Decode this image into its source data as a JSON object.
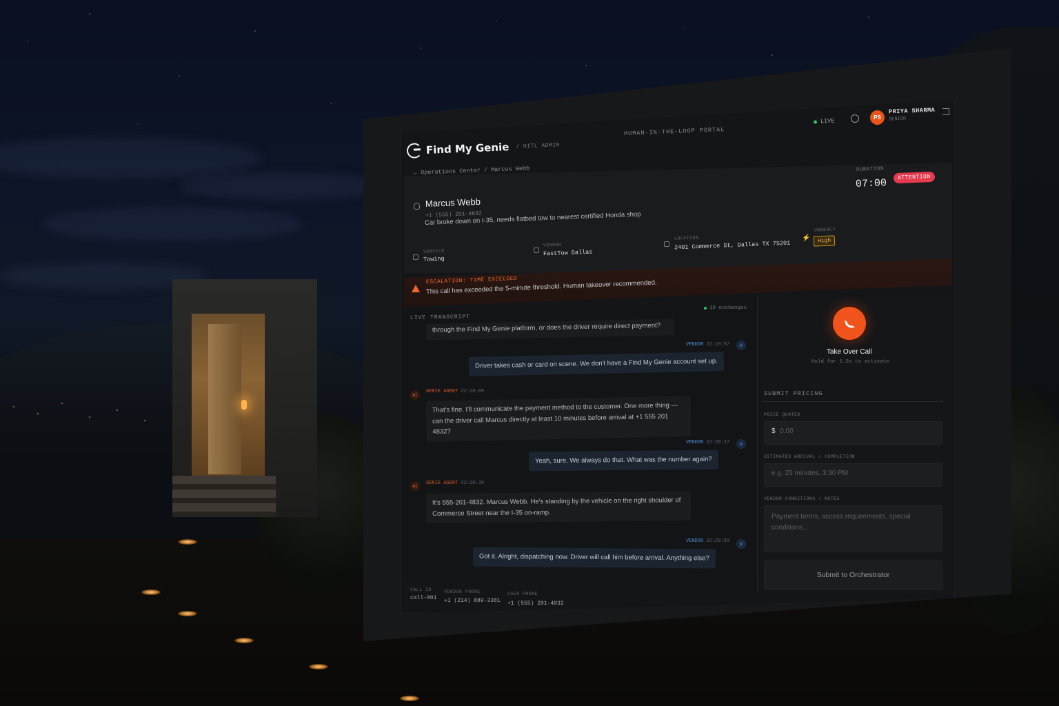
{
  "header": {
    "brand_name": "Find My Genie",
    "brand_sub": "/ HITL ADMIN",
    "portal_label": "HUMAN-IN-THE-LOOP PORTAL",
    "live_label": "LIVE",
    "user": {
      "initials": "PS",
      "name": "PRIYA SHARMA",
      "role": "SENIOR"
    }
  },
  "breadcrumb": {
    "text": "← Operations Center / Marcus Webb"
  },
  "call": {
    "duration_label": "DURATION",
    "duration_value": "07:00",
    "status_badge": "ATTENTION",
    "caller_name": "Marcus Webb",
    "caller_phone": "+1 (555) 201-4832",
    "issue": "Car broke down on I-35, needs flatbed tow to nearest certified Honda shop",
    "service_label": "SERVICE",
    "service_value": "Towing",
    "vendor_label": "VENDOR",
    "vendor_value": "FastTow Dallas",
    "location_label": "LOCATION",
    "location_value": "2401 Commerce St, Dallas TX 75201",
    "urgency_label": "URGENCY",
    "urgency_value": "High"
  },
  "escalation": {
    "title": "ESCALATION: TIME EXCEEDED",
    "message": "This call has exceeded the 5-minute threshold. Human takeover recommended."
  },
  "transcript": {
    "title": "LIVE TRANSCRIPT",
    "exchanges": "18 exchanges",
    "truncated_top": "through the Find My Genie platform, or does the driver require direct payment?",
    "messages": [
      {
        "role": "vendor",
        "speaker": "VENDOR",
        "time": "22:19:57",
        "badge": "V",
        "text": "Driver takes cash or card on scene. We don't have a Find My Genie account set up."
      },
      {
        "role": "agent",
        "speaker": "GENIE AGENT",
        "time": "22:20:09",
        "badge": "AI",
        "text_line1": "That's fine. I'll communicate the payment method to the customer. One more thing —",
        "text_line2": "can the driver call Marcus directly at least 10 minutes before arrival at +1 555 201 4832?"
      },
      {
        "role": "vendor",
        "speaker": "VENDOR",
        "time": "22:20:27",
        "badge": "V",
        "text": "Yeah, sure. We always do that. What was the number again?"
      },
      {
        "role": "agent",
        "speaker": "GENIE AGENT",
        "time": "22:20:39",
        "badge": "AI",
        "text_line1": "It's 555-201-4832. Marcus Webb. He's standing by the vehicle on the right shoulder of",
        "text_line2": "Commerce Street near the I-35 on-ramp."
      },
      {
        "role": "vendor",
        "speaker": "VENDOR",
        "time": "22:20:59",
        "badge": "V",
        "text": "Got it. Alright, dispatching now. Driver will call him before arrival. Anything else?"
      }
    ]
  },
  "footer": {
    "call_id_label": "CALL ID",
    "call_id_value": "call-001",
    "vendor_phone_label": "VENDOR PHONE",
    "vendor_phone_value": "+1 (214) 889-3301",
    "user_phone_label": "USER PHONE",
    "user_phone_value": "+1 (555) 201-4832"
  },
  "takeover": {
    "label": "Take Over Call",
    "hint": "Hold for 1.5s to activate"
  },
  "pricing": {
    "title": "SUBMIT PRICING",
    "price_label": "PRICE QUOTED",
    "price_currency": "$",
    "price_placeholder": "0.00",
    "eta_label": "ESTIMATED ARRIVAL / COMPLETION",
    "eta_placeholder": "e.g. 25 minutes, 3:30 PM",
    "notes_label": "VENDOR CONDITIONS / NOTES",
    "notes_placeholder": "Payment terms, access requirements, special conditions...",
    "submit_label": "Submit to Orchestrator"
  },
  "colors": {
    "accent": "#f0541c",
    "attention": "#e63a4e",
    "vendor_blue": "#4e8fd8",
    "agent_orange": "#d2552a",
    "urgency": "#f0b648",
    "live": "#2fc46a"
  }
}
